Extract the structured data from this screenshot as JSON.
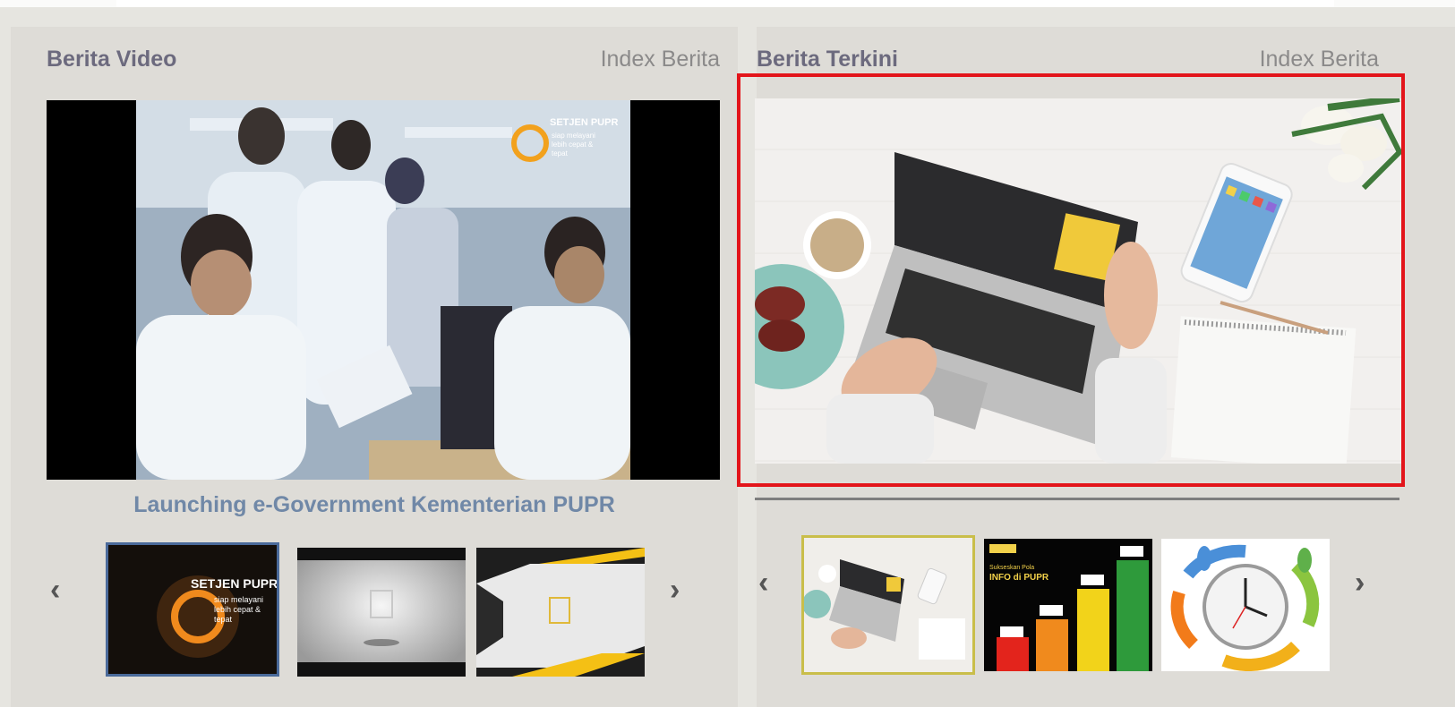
{
  "left_panel": {
    "title": "Berita Video",
    "index_link": "Index Berita",
    "video": {
      "logo_text": "SETJEN PUPR",
      "logo_tagline_1": "siap melayani",
      "logo_tagline_2": "lebih cepat &",
      "logo_tagline_3": "tepat"
    },
    "caption": "Launching e-Government Kementerian PUPR",
    "thumbnails": [
      {
        "logo_text": "SETJEN PUPR",
        "tagline_1": "siap melayani",
        "tagline_2": "lebih cepat &",
        "tagline_3": "tepat"
      },
      {},
      {}
    ]
  },
  "right_panel": {
    "title": "Berita Terkini",
    "index_link": "Index Berita",
    "thumbnails": [
      {},
      {
        "heading": "INFO di PUPR"
      },
      {}
    ]
  },
  "colors": {
    "panel_bg": "#dedcd7",
    "title": "#6c6a7e",
    "link": "#8b8a8a",
    "caption": "#7088a7",
    "highlight_border": "#e3151b",
    "thumb_active_left": "#4a6a9a",
    "thumb_active_right": "#c9be4a"
  },
  "icons": {
    "prev": "chevron-left-icon",
    "next": "chevron-right-icon"
  }
}
